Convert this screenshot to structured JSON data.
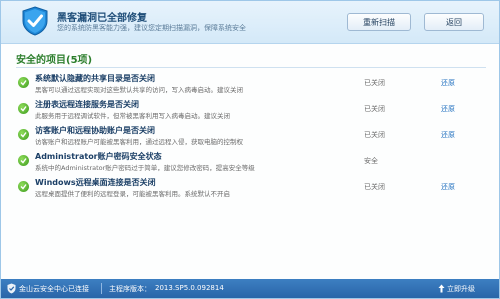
{
  "header": {
    "title": "黑客漏洞已全部修复",
    "subtitle": "您的系统防黑客能力强，建议您定期扫描漏洞，保障系统安全",
    "rescan_label": "重新扫描",
    "back_label": "返回"
  },
  "section": {
    "title": "安全的项目(5项)"
  },
  "items": [
    {
      "title": "系统默认隐藏的共享目录是否关闭",
      "desc": "黑客可以通过远程实现对这些默认共享的访问，写入病毒启动。建议关闭",
      "status": "已关闭",
      "action": "还原"
    },
    {
      "title": "注册表远程连接服务是否关闭",
      "desc": "此服务用于远程调试软件，但常被黑客利用写入病毒启动。建议关闭",
      "status": "已关闭",
      "action": "还原"
    },
    {
      "title": "访客账户和远程协助账户是否关闭",
      "desc": "访客账户和远程账户可能被黑客利用，通过远程入侵，获取电脑的控制权",
      "status": "已关闭",
      "action": "还原"
    },
    {
      "title": "Administrator账户密码安全状态",
      "desc": "系统中的Administrator账户密码过于简单，建议您修改密码，提高安全等级",
      "status": "安全",
      "action": ""
    },
    {
      "title": "Windows远程桌面连接是否关闭",
      "desc": "远程桌面提供了便利的远程登录，可能被黑客利用。系统默认不开启",
      "status": "已关闭",
      "action": "还原"
    }
  ],
  "footer": {
    "status": "金山云安全中心已连接",
    "version_label": "主程序版本：",
    "version": "2013.SP5.0.092814",
    "upgrade_label": "立即升级"
  },
  "colors": {
    "accent": "#2a65a8",
    "safe_green": "#3c9a1d",
    "link_blue": "#1f6fbf"
  }
}
